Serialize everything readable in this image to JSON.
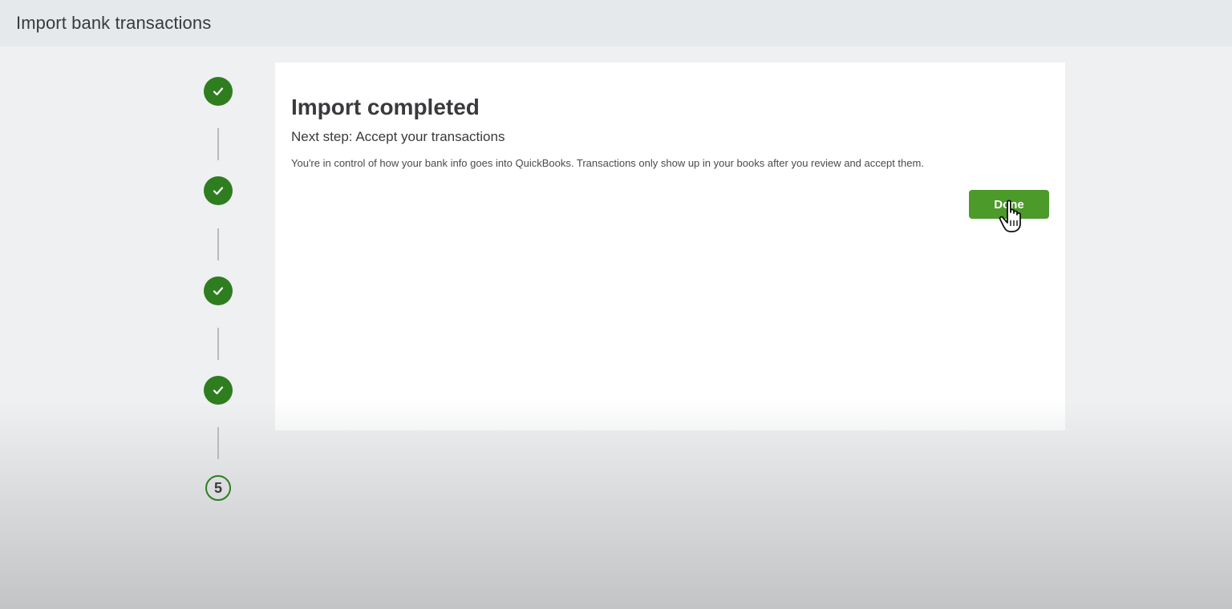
{
  "header": {
    "title": "Import bank transactions"
  },
  "stepper": {
    "completed_steps": 4,
    "current_step_label": "5",
    "accent_color": "#2e7d1f"
  },
  "main": {
    "heading": "Import completed",
    "subheading": "Next step: Accept your transactions",
    "description": "You're in control of how your bank info goes into QuickBooks. Transactions only show up in your books after you review and accept them.",
    "done_button": "Done",
    "button_color": "#4c9a2a"
  },
  "icons": {
    "step_done": "checkmark-icon",
    "pointer": "hand-pointer-icon"
  }
}
